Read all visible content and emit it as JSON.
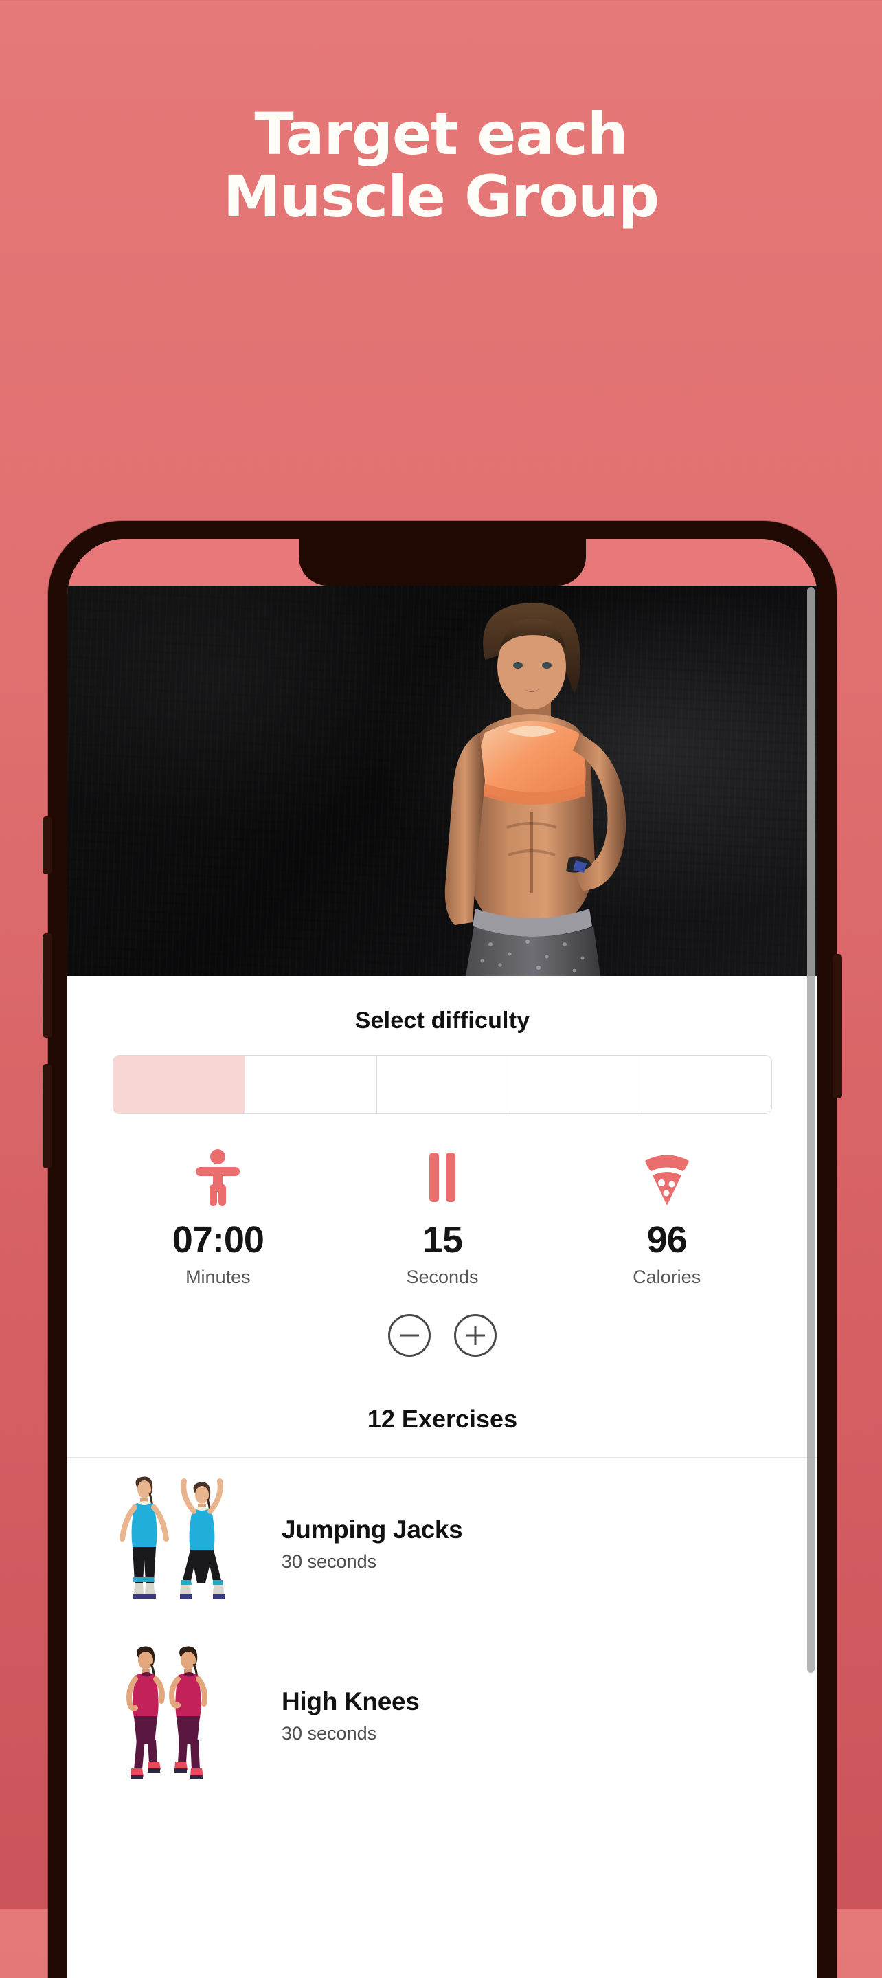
{
  "marketing": {
    "headline_line1": "Target each",
    "headline_line2": "Muscle Group",
    "background_top": "#E57878",
    "background_bottom": "#CA5459",
    "text_color": "#FFFDF8"
  },
  "phone": {
    "frame_color": "#210A03",
    "statusbar_color": "#E8787A"
  },
  "screen": {
    "hero": {
      "alt": "fitness model in orange sports bra against dark wall"
    },
    "difficulty": {
      "title": "Select difficulty",
      "segments": 5,
      "selected_index": 0,
      "active_color": "#F7D6D4",
      "border_color": "#DBDBDB"
    },
    "stats": [
      {
        "icon": "person-icon",
        "value": "07:00",
        "label": "Minutes",
        "color": "#EA6E6E"
      },
      {
        "icon": "pause-icon",
        "value": "15",
        "label": "Seconds",
        "color": "#EA6E6E"
      },
      {
        "icon": "pizza-icon",
        "value": "96",
        "label": "Calories",
        "color": "#EA6E6E"
      }
    ],
    "steppers": {
      "decrease_label": "−",
      "increase_label": "+"
    },
    "exercises_header": "12 Exercises",
    "exercises": [
      {
        "name": "Jumping Jacks",
        "duration": "30 seconds",
        "thumb": "jumping-jacks-thumb"
      },
      {
        "name": "High Knees",
        "duration": "30 seconds",
        "thumb": "high-knees-thumb"
      }
    ]
  }
}
